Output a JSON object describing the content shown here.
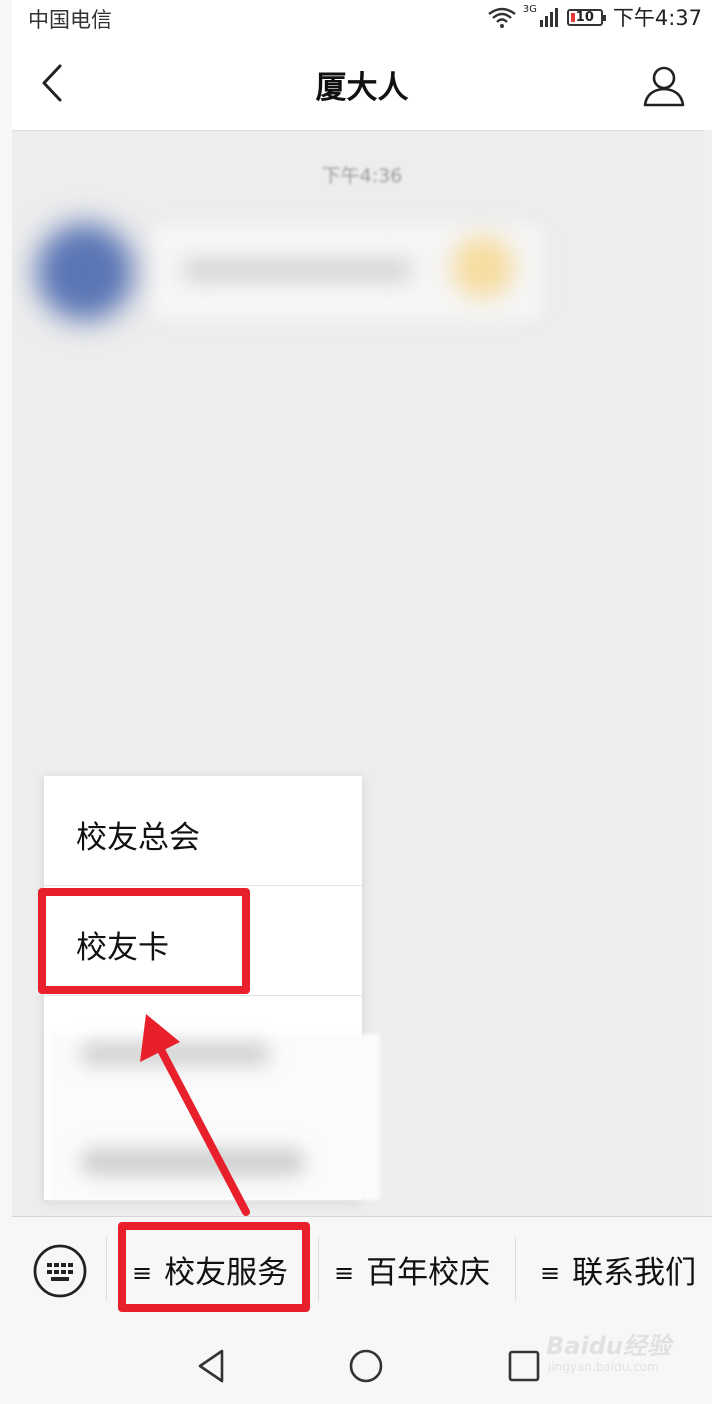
{
  "status_bar": {
    "carrier": "中国电信",
    "network": "3G",
    "battery": "10",
    "time": "下午4:37"
  },
  "header": {
    "title": "厦大人"
  },
  "chat": {
    "timestamp": "下午4:36"
  },
  "popup_menu": {
    "items": [
      {
        "label": "校友总会"
      },
      {
        "label": "校友卡"
      }
    ]
  },
  "menu_bar": {
    "tabs": [
      {
        "icon": "≡",
        "label": "校友服务"
      },
      {
        "icon": "≡",
        "label": "百年校庆"
      },
      {
        "icon": "≡",
        "label": "联系我们"
      }
    ]
  },
  "annotation": {
    "color": "#e8202c"
  },
  "watermark": {
    "logo": "Baidu经验",
    "url": "jingyan.baidu.com"
  }
}
